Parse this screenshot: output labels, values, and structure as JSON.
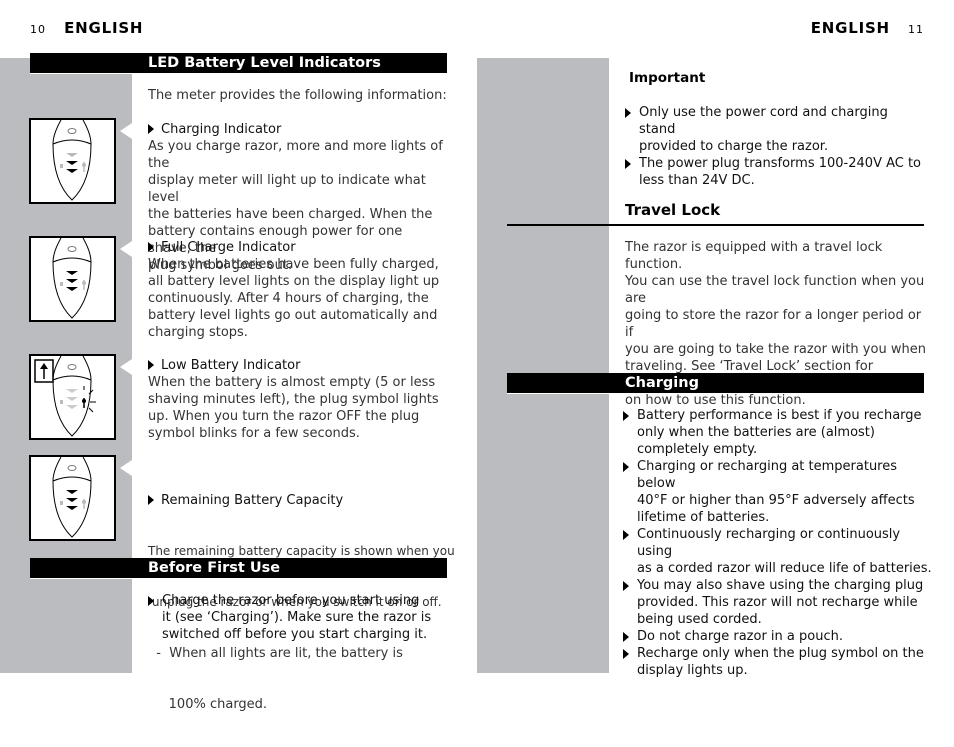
{
  "left_page": {
    "page_number": "10",
    "header": "ENGLISH",
    "led_section": {
      "title": "LED Battery Level Indicators",
      "intro": "The meter provides the following information:",
      "items": [
        {
          "title": "Charging Indicator",
          "lines": [
            "As you charge razor, more and more lights of the",
            "display meter will light up to indicate what level",
            "the batteries have been charged. When the",
            "battery contains enough power for one shave, the",
            "plug symbol goes out."
          ],
          "figure": "razor-charging-display-icon"
        },
        {
          "title": "Full Charge Indicator",
          "lines": [
            "When the batteries have been fully charged,",
            "all battery level lights on the display light up",
            "continuously. After 4 hours of charging, the",
            "battery level lights go out automatically and",
            "charging stops."
          ],
          "figure": "razor-full-charge-display-icon"
        },
        {
          "title": "Low Battery Indicator",
          "lines": [
            "When the battery is almost empty (5 or less",
            "shaving minutes left), the plug symbol lights",
            "up.  When you turn the razor OFF the plug",
            "symbol blinks for a few seconds."
          ],
          "figure": "razor-low-battery-display-icon"
        },
        {
          "title": "Remaining Battery Capacity",
          "lines": [
            "The remaining battery capacity is shown when you",
            " unplug the razor or when you switch it on or off.",
            "  -  When all lights are lit, the battery is",
            "     100% charged."
          ],
          "figure": "razor-remaining-capacity-display-icon"
        }
      ]
    },
    "before_first_use": {
      "title": "Before First Use",
      "bullets": [
        [
          "Charge the razor before you start using",
          "it (see ‘Charging’).  Make sure the razor is",
          "switched off before you start charging it."
        ]
      ]
    }
  },
  "right_page": {
    "page_number": "11",
    "header": "ENGLISH",
    "important": {
      "title": "Important",
      "bullets": [
        [
          "Only use the power cord and charging stand",
          "provided to charge the razor."
        ],
        [
          "The power plug transforms 100-240V AC to",
          "less than 24V DC."
        ]
      ]
    },
    "travel_lock": {
      "title": "Travel Lock",
      "lines": [
        "The razor is equipped with a travel lock function.",
        "You can use the travel lock function when you are",
        "going to store the razor for a longer period or if",
        "you are going to take the razor with you when",
        "traveling.  See ‘Travel Lock’ section for instructions",
        "on how to use this function."
      ]
    },
    "charging": {
      "title": "Charging",
      "bullets": [
        [
          "Battery performance is best if you recharge",
          "only when the batteries are (almost)",
          "completely empty."
        ],
        [
          "Charging or recharging at temperatures below",
          "40°F or higher than 95°F adversely affects",
          "lifetime of batteries."
        ],
        [
          "Continuously recharging or continuously using",
          "as a corded razor will reduce life of batteries."
        ],
        [
          "You may also shave using the charging plug",
          "provided. This razor will not recharge while",
          "being used corded."
        ],
        [
          "Do not charge razor in a pouch."
        ],
        [
          "Recharge only when the plug symbol on the",
          "display lights up."
        ]
      ]
    }
  },
  "colors": {
    "sidebar_gray": "#bbbcbf",
    "bar_black": "#000000",
    "text": "#333333"
  }
}
